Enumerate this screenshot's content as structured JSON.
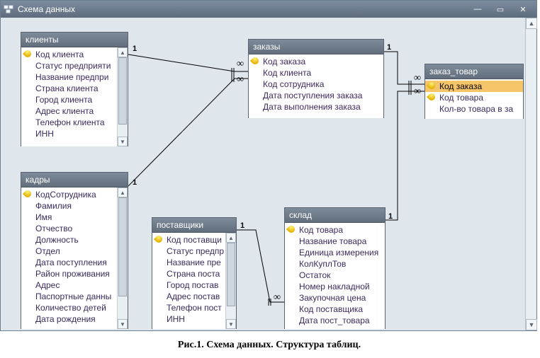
{
  "window": {
    "title": "Схема данных",
    "buttons": {
      "min": "—",
      "max": "▭",
      "close": "✕"
    }
  },
  "caption": "Рис.1. Схема данных. Структура таблиц.",
  "relationships": [
    {
      "from": "клиенты.Код клиента",
      "to": "заказы.Код клиента",
      "type": "1:∞"
    },
    {
      "from": "кадры.КодСотрудника",
      "to": "заказы.Код сотрудника",
      "type": "1:∞"
    },
    {
      "from": "заказы.Код заказа",
      "to": "заказ_товар.Код заказа",
      "type": "1:∞"
    },
    {
      "from": "склад.Код товара",
      "to": "заказ_товар.Код товара",
      "type": "1:∞"
    },
    {
      "from": "поставщики.Код поставщика",
      "to": "склад.Код поставщика",
      "type": "1:∞"
    }
  ],
  "tables": {
    "clients": {
      "title": "клиенты",
      "fields": [
        {
          "name": "Код клиента",
          "pk": true
        },
        {
          "name": "Статус предприяти"
        },
        {
          "name": "Название предпри"
        },
        {
          "name": "Страна клиента"
        },
        {
          "name": "Город клиента"
        },
        {
          "name": "Адрес клиента"
        },
        {
          "name": "Телефон клиента"
        },
        {
          "name": "ИНН"
        }
      ]
    },
    "orders": {
      "title": "заказы",
      "fields": [
        {
          "name": "Код заказа",
          "pk": true
        },
        {
          "name": "Код клиента"
        },
        {
          "name": "Код сотрудника"
        },
        {
          "name": "Дата поступления заказа"
        },
        {
          "name": "Дата выполнения заказа"
        }
      ]
    },
    "order_item": {
      "title": "заказ_товар",
      "fields": [
        {
          "name": "Код заказа",
          "pk": true,
          "sel": true
        },
        {
          "name": "Код товара",
          "pk": true
        },
        {
          "name": "Кол-во товара в за"
        }
      ]
    },
    "staff": {
      "title": "кадры",
      "fields": [
        {
          "name": "КодСотрудника",
          "pk": true
        },
        {
          "name": "Фамилия"
        },
        {
          "name": "Имя"
        },
        {
          "name": "Отчество"
        },
        {
          "name": "Должность"
        },
        {
          "name": "Отдел"
        },
        {
          "name": "Дата поступления"
        },
        {
          "name": "Район проживания"
        },
        {
          "name": "Адрес"
        },
        {
          "name": "Паспортные данны"
        },
        {
          "name": "Количество детей"
        },
        {
          "name": "Дата рождения"
        }
      ]
    },
    "suppliers": {
      "title": "поставщики",
      "fields": [
        {
          "name": "Код поставщи",
          "pk": true
        },
        {
          "name": "Статус предпр"
        },
        {
          "name": "Название пре"
        },
        {
          "name": "Страна поста"
        },
        {
          "name": "Город постав"
        },
        {
          "name": "Адрес постав"
        },
        {
          "name": "Телефон пост"
        },
        {
          "name": "ИНН"
        }
      ]
    },
    "stock": {
      "title": "склад",
      "fields": [
        {
          "name": "Код товара",
          "pk": true
        },
        {
          "name": "Название товара"
        },
        {
          "name": "Единица измерения"
        },
        {
          "name": "КолКуплТов"
        },
        {
          "name": "Остаток"
        },
        {
          "name": "Номер накладной"
        },
        {
          "name": "Закупочная цена"
        },
        {
          "name": "Код поставщика"
        },
        {
          "name": "Дата пост_товара"
        }
      ]
    }
  },
  "rel_labels": {
    "one": "1",
    "many": "∞"
  }
}
